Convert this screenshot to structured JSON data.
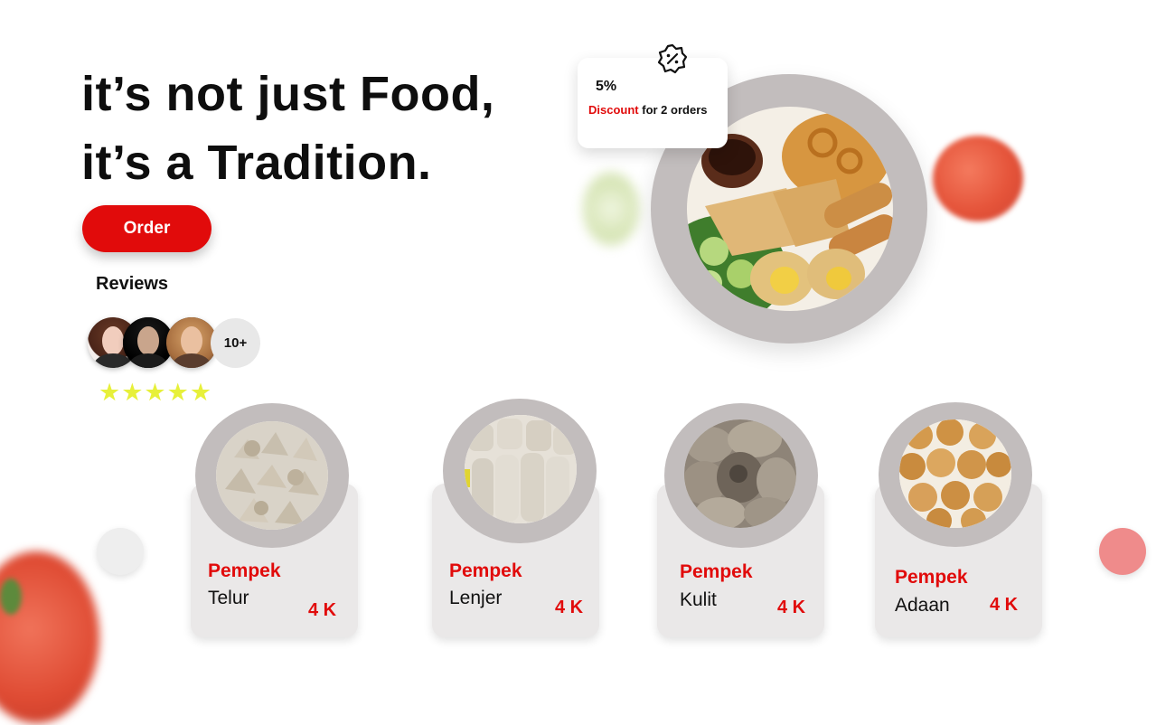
{
  "hero": {
    "line1": "it’s not just Food,",
    "line2": "it’s a Tradition.",
    "order_label": "Order"
  },
  "reviews": {
    "title": "Reviews",
    "more_count": "10+",
    "stars": "★★★★★",
    "rating_stars": 5
  },
  "discount": {
    "percent": "5%",
    "highlight": "Discount",
    "text": " for 2 orders"
  },
  "products": [
    {
      "category": "Pempek",
      "name": "Telur",
      "price": "4 K"
    },
    {
      "category": "Pempek",
      "name": "Lenjer",
      "price": "4 K"
    },
    {
      "category": "Pempek",
      "name": "Kulit",
      "price": "4 K"
    },
    {
      "category": "Pempek",
      "name": "Adaan",
      "price": "4 K"
    }
  ],
  "colors": {
    "accent": "#e10b0b",
    "ring_gray": "#c2bdbd",
    "card_bg": "#eae8e8",
    "star": "#e7f03a",
    "nav_next": "#ef8b8b"
  },
  "icons": [
    "discount-badge-icon",
    "star-icon",
    "tomato-decoration",
    "lime-decoration"
  ]
}
